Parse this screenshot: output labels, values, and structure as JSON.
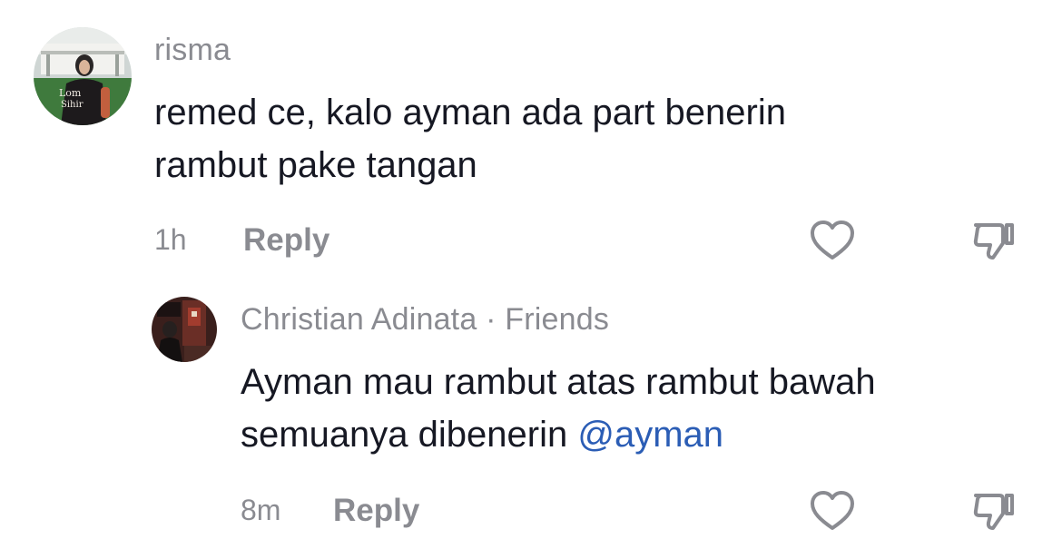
{
  "comments": [
    {
      "username": "risma",
      "avatar": "profile-photo-risma",
      "text_lines": [
        "remed ce, kalo ayman ada part benerin",
        "rambut pake tangan"
      ],
      "time": "1h",
      "reply_label": "Reply",
      "like_icon": "heart-outline-icon",
      "dislike_icon": "thumbs-down-outline-icon"
    },
    {
      "username": "Christian Adinata",
      "separator": "·",
      "relationship": "Friends",
      "avatar": "profile-photo-christian-adinata",
      "text_lines": [
        "Ayman mau rambut atas rambut bawah",
        "semuanya dibenerin"
      ],
      "mention": "@ayman",
      "time": "8m",
      "reply_label": "Reply",
      "like_icon": "heart-outline-icon",
      "dislike_icon": "thumbs-down-outline-icon"
    }
  ],
  "colors": {
    "text": "#161823",
    "secondary": "#8a8b91",
    "mention": "#2b5db5"
  }
}
